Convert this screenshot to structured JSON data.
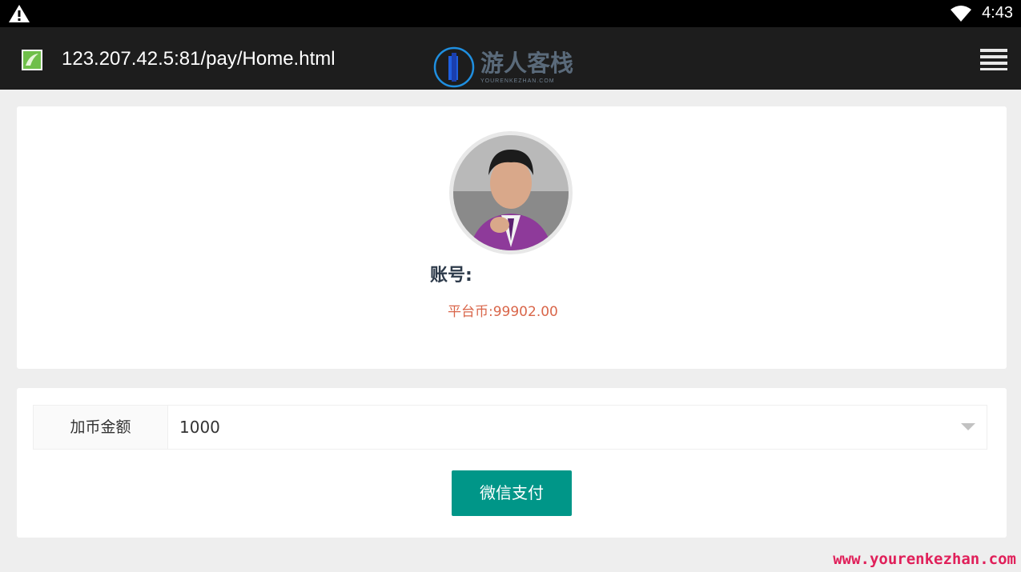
{
  "status_bar": {
    "time": "4:43",
    "icons": [
      "warning-icon",
      "wifi-icon"
    ]
  },
  "browser": {
    "url": "123.207.42.5:81/pay/Home.html",
    "icons": [
      "site-favicon-icon",
      "menu-icon"
    ]
  },
  "watermark": {
    "brand_cn": "游人客栈",
    "brand_en": "YOURENKEZHAN.COM",
    "footer_url": "www.yourenkezhan.com"
  },
  "profile": {
    "account_label": "账号:",
    "coin_label": "平台币:",
    "coin_value": "99902.00"
  },
  "payment": {
    "amount_label": "加币金额",
    "amount_value": "1000",
    "pay_button": "微信支付"
  },
  "colors": {
    "pay_button": "#009688",
    "coin_text": "#d9664a",
    "toolbar": "#1d1d1d"
  }
}
